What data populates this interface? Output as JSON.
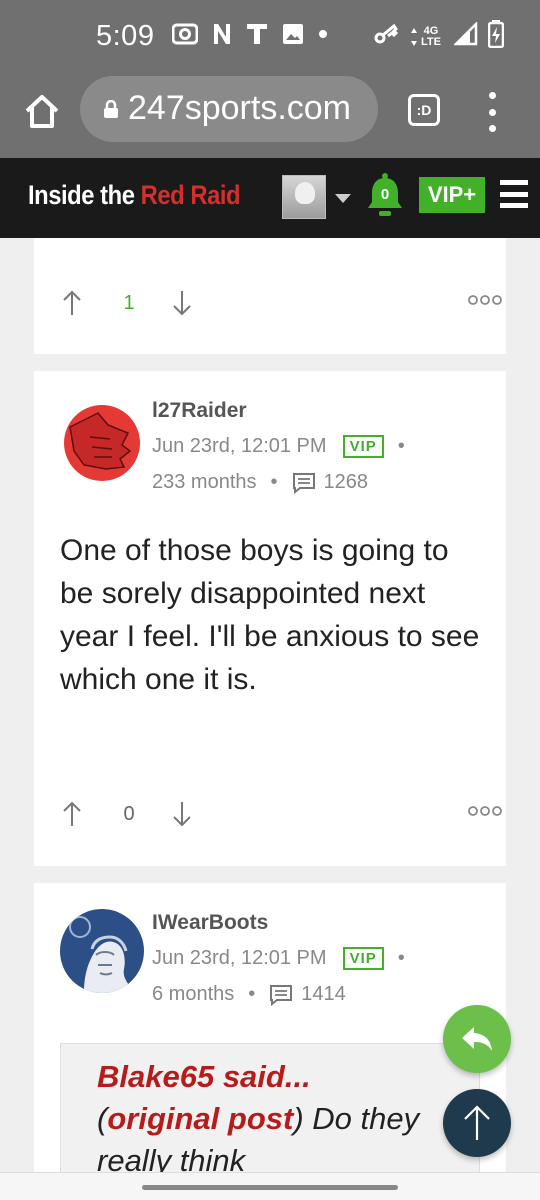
{
  "status_bar": {
    "time": "5:09",
    "icons_left": [
      "radio-icon",
      "n-icon",
      "t-icon",
      "image-icon",
      "dot-icon"
    ],
    "network": "4G LTE",
    "icons_right": [
      "key-icon",
      "signal-icon",
      "battery-charging-icon"
    ]
  },
  "browser": {
    "url": "247sports.com",
    "tab_label": ":D"
  },
  "site_header": {
    "brand_prefix": "Inside the ",
    "brand_highlight": "Red Raid",
    "notification_count": "0",
    "vip_label": "VIP+"
  },
  "posts": [
    {
      "upvotes": "1",
      "more": "ooo"
    },
    {
      "username": "l27Raider",
      "date": "Jun 23rd, 12:01 PM",
      "badge": "VIP",
      "tenure": "233 months",
      "post_count": "1268",
      "body": "One of those boys is going to be sorely disappointed next year I feel. I'll be anxious to see which one it is.",
      "upvotes": "0",
      "more": "ooo"
    },
    {
      "username": "IWearBoots",
      "date": "Jun 23rd, 12:01 PM",
      "badge": "VIP",
      "tenure": "6 months",
      "post_count": "1414",
      "quote_author": "Blake65 said...",
      "quote_open": "(",
      "quote_link": "original post",
      "quote_text": ") Do they really think"
    }
  ],
  "separator": "•",
  "colors": {
    "accent_green": "#43b02a",
    "brand_red": "#d32f2f",
    "header_bg": "#1a1a1a",
    "chrome_grey": "#707070"
  }
}
